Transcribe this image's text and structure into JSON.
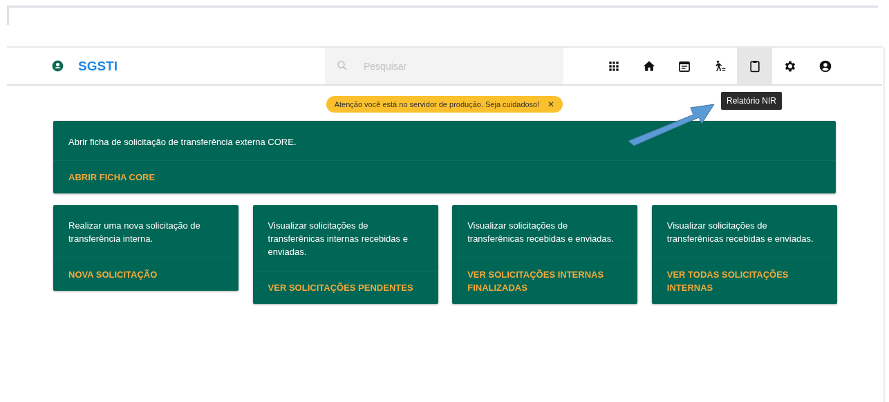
{
  "header": {
    "app_name": "SGSTI",
    "search": {
      "placeholder": "Pesquisar"
    },
    "nav_icons": [
      {
        "kind": "apps",
        "selected": false
      },
      {
        "kind": "home",
        "selected": false
      },
      {
        "kind": "calendar",
        "selected": false
      },
      {
        "kind": "walker",
        "selected": false
      },
      {
        "kind": "clipboard",
        "selected": true
      },
      {
        "kind": "settings",
        "selected": false
      },
      {
        "kind": "account",
        "selected": false
      }
    ],
    "tooltip": "Relatório NIR"
  },
  "alert": {
    "text": "Atenção você está no servidor de produção. Seja cuidadoso!",
    "close": "✕"
  },
  "main_card": {
    "text": "Abrir ficha de solicitação de transferência externa CORE.",
    "action": "ABRIR FICHA CORE"
  },
  "cards": [
    {
      "text": "Realizar uma nova solicitação de transferência interna.",
      "action": "NOVA SOLICITAÇÃO"
    },
    {
      "text": "Visualizar solicitações de transferênicas internas recebidas e enviadas.",
      "action": "VER SOLICITAÇÕES PENDENTES"
    },
    {
      "text": "Visualizar solicitações de transferênicas recebidas e enviadas.",
      "action": "VER SOLICITAÇÕES INTERNAS FINALIZADAS"
    },
    {
      "text": "Visualizar solicitações de transferênicas recebidas e enviadas.",
      "action": "VER TODAS SOLICITAÇÕES INTERNAS"
    }
  ]
}
